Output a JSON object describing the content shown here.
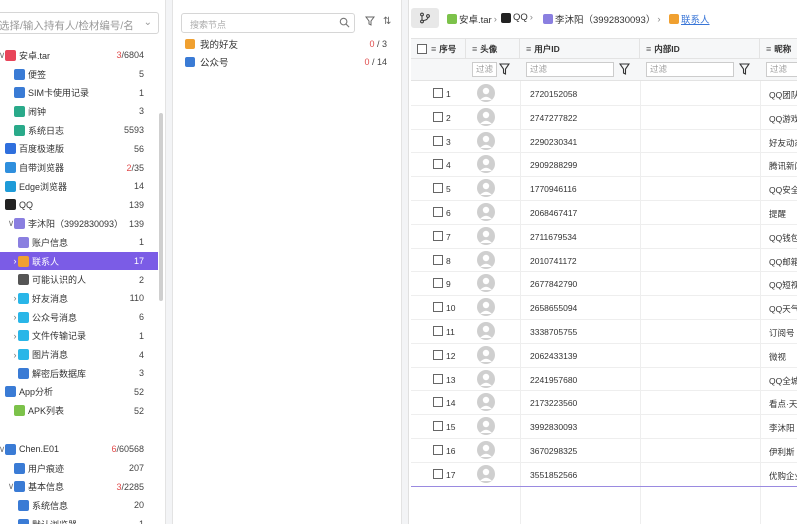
{
  "left_panel": {
    "search_placeholder": "选择/输入持有人/检材编号/名",
    "tree": [
      {
        "label": "安卓.tar",
        "count_red": "3",
        "count": "/6804",
        "level": 0,
        "arrow": "∨",
        "icon": "android-icon",
        "color": "#e8455a"
      },
      {
        "label": "便签",
        "count": "5",
        "level": 1,
        "icon": "note-icon",
        "color": "#3a7bd5"
      },
      {
        "label": "SIM卡使用记录",
        "count": "1",
        "level": 1,
        "icon": "sim-card-icon",
        "color": "#3a7bd5"
      },
      {
        "label": "闹钟",
        "count": "3",
        "level": 1,
        "icon": "clock-icon",
        "color": "#2aaa8a"
      },
      {
        "label": "系统日志",
        "count": "5593",
        "level": 1,
        "icon": "log-icon",
        "color": "#2aaa8a"
      },
      {
        "label": "百度极速版",
        "count": "56",
        "level": 0,
        "icon": "baidu-icon",
        "color": "#2f6fdd"
      },
      {
        "label": "自带浏览器",
        "count_red": "2",
        "count": "/35",
        "level": 0,
        "icon": "browser-icon",
        "color": "#2f8fdd"
      },
      {
        "label": "Edge浏览器",
        "count": "14",
        "level": 0,
        "icon": "edge-icon",
        "color": "#1e9bd8"
      },
      {
        "label": "QQ",
        "count": "139",
        "level": 0,
        "icon": "qq-icon",
        "color": "#222222"
      },
      {
        "label": "李沐阳（3992830093）",
        "count": "139",
        "level": 1,
        "arrow": "∨",
        "icon": "user-icon",
        "color": "#8a7fe0"
      },
      {
        "label": "账户信息",
        "count": "1",
        "level": 2,
        "icon": "account-icon",
        "color": "#8a7fe0"
      },
      {
        "label": "联系人",
        "count": "17",
        "level": 2,
        "arrow": "›",
        "icon": "contacts-icon",
        "color": "#f0a030",
        "selected": true
      },
      {
        "label": "可能认识的人",
        "count": "2",
        "level": 2,
        "icon": "people-icon",
        "color": "#555555"
      },
      {
        "label": "好友消息",
        "count": "110",
        "level": 2,
        "arrow": "›",
        "icon": "chat-icon",
        "color": "#29b6e8"
      },
      {
        "label": "公众号消息",
        "count": "6",
        "level": 2,
        "arrow": "›",
        "icon": "chat-icon",
        "color": "#29b6e8"
      },
      {
        "label": "文件传输记录",
        "count": "1",
        "level": 2,
        "arrow": "›",
        "icon": "chat-icon",
        "color": "#29b6e8"
      },
      {
        "label": "图片消息",
        "count": "4",
        "level": 2,
        "arrow": "›",
        "icon": "chat-icon",
        "color": "#29b6e8"
      },
      {
        "label": "解密后数据库",
        "count": "3",
        "level": 2,
        "icon": "database-icon",
        "color": "#3a7bd5"
      },
      {
        "label": "App分析",
        "count": "52",
        "level": 0,
        "icon": "apps-icon",
        "color": "#3a7bd5"
      },
      {
        "label": "APK列表",
        "count": "52",
        "level": 1,
        "icon": "apk-icon",
        "color": "#7cc24a"
      },
      {
        "label": "Chen.E01",
        "count_red": "6",
        "count": "/60568",
        "level": 0,
        "arrow": "∨",
        "icon": "disk-icon",
        "color": "#3a7bd5",
        "gap": true
      },
      {
        "label": "用户痕迹",
        "count": "207",
        "level": 1,
        "icon": "trace-icon",
        "color": "#3a7bd5"
      },
      {
        "label": "基本信息",
        "count_red": "3",
        "count": "/2285",
        "level": 1,
        "arrow": "∨",
        "icon": "info-icon",
        "color": "#3a7bd5"
      },
      {
        "label": "系统信息",
        "count": "20",
        "level": 2,
        "icon": "system-icon",
        "color": "#3a7bd5"
      },
      {
        "label": "默认浏览器",
        "count": "1",
        "level": 2,
        "icon": "browser-icon",
        "color": "#3a7bd5"
      }
    ]
  },
  "middle_panel": {
    "search_placeholder": "搜索节点",
    "items": [
      {
        "label": "我的好友",
        "count_red": "0",
        "count": " / 3",
        "icon": "friends-icon",
        "color": "#f0a030"
      },
      {
        "label": "公众号",
        "count_red": "0",
        "count": " / 14",
        "icon": "official-account-icon",
        "color": "#3a7bd5"
      }
    ]
  },
  "breadcrumb": [
    {
      "label": "安卓.tar",
      "icon": "android-icon",
      "color": "#7cc24a"
    },
    {
      "label": "QQ",
      "icon": "qq-icon",
      "color": "#222222"
    },
    {
      "label": "李沐阳（3992830093）",
      "icon": "user-icon",
      "color": "#8a7fe0"
    },
    {
      "label": "联系人",
      "icon": "contacts-icon",
      "color": "#f0a030",
      "active": true
    }
  ],
  "table": {
    "columns": [
      "序号",
      "头像",
      "用户ID",
      "内部ID",
      "昵称"
    ],
    "filter_placeholder": "过滤",
    "rows": [
      {
        "seq": "1",
        "uid": "2720152058",
        "nick": "QQ团队"
      },
      {
        "seq": "2",
        "uid": "2747277822",
        "nick": "QQ游戏"
      },
      {
        "seq": "3",
        "uid": "2290230341",
        "nick": "好友动态"
      },
      {
        "seq": "4",
        "uid": "2909288299",
        "nick": "腾讯新闻"
      },
      {
        "seq": "5",
        "uid": "1770946116",
        "nick": "QQ安全"
      },
      {
        "seq": "6",
        "uid": "2068467417",
        "nick": "提醒"
      },
      {
        "seq": "7",
        "uid": "2711679534",
        "nick": "QQ钱包"
      },
      {
        "seq": "8",
        "uid": "2010741172",
        "nick": "QQ邮箱"
      },
      {
        "seq": "9",
        "uid": "2677842790",
        "nick": "QQ短视"
      },
      {
        "seq": "10",
        "uid": "2658655094",
        "nick": "QQ天气"
      },
      {
        "seq": "11",
        "uid": "3338705755",
        "nick": "订阅号"
      },
      {
        "seq": "12",
        "uid": "2062433139",
        "nick": "微视"
      },
      {
        "seq": "13",
        "uid": "2241957680",
        "nick": "QQ全城"
      },
      {
        "seq": "14",
        "uid": "2173223560",
        "nick": "看点·天"
      },
      {
        "seq": "15",
        "uid": "3992830093",
        "nick": "李沐阳"
      },
      {
        "seq": "16",
        "uid": "3670298325",
        "nick": "伊利斯"
      },
      {
        "seq": "17",
        "uid": "3551852566",
        "nick": "优购企业"
      }
    ]
  }
}
